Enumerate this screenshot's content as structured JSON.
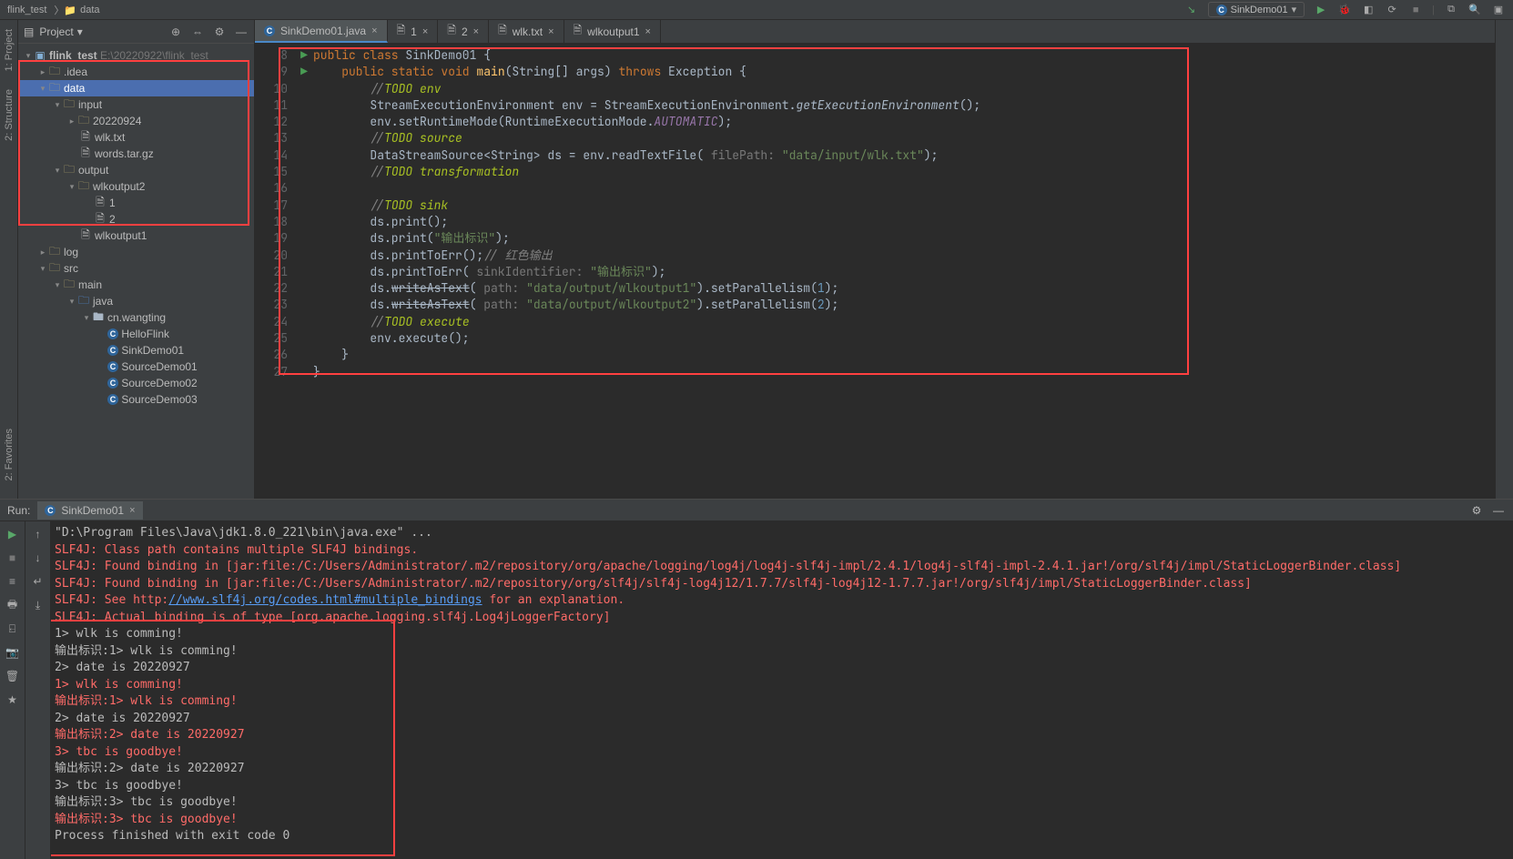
{
  "breadcrumb": {
    "root": "flink_test",
    "current": "data"
  },
  "runConfig": "SinkDemo01",
  "projectPanel": {
    "title": "Project",
    "root": {
      "name": "flink_test",
      "path": "E:\\20220922\\flink_test"
    }
  },
  "tree": {
    "idea": ".idea",
    "data": "data",
    "input": "input",
    "date20220924": "20220924",
    "wlktxt": "wlk.txt",
    "wordstar": "words.tar.gz",
    "output": "output",
    "wlkoutput2": "wlkoutput2",
    "f1": "1",
    "f2": "2",
    "wlkoutput1": "wlkoutput1",
    "log": "log",
    "src": "src",
    "main": "main",
    "java": "java",
    "pkg": "cn.wangting",
    "helloflink": "HelloFlink",
    "sinkdemo01": "SinkDemo01",
    "sourcedemo01": "SourceDemo01",
    "sourcedemo02": "SourceDemo02",
    "sourcedemo03": "SourceDemo03"
  },
  "tabs": {
    "t1": "SinkDemo01.java",
    "t2": "1",
    "t3": "2",
    "t4": "wlk.txt",
    "t5": "wlkoutput1"
  },
  "code": {
    "l8": "public class SinkDemo01 {",
    "l9": "    public static void main(String[] args) throws Exception {",
    "l10": "        //TODO env",
    "l11": "        StreamExecutionEnvironment env = StreamExecutionEnvironment.getExecutionEnvironment();",
    "l12": "        env.setRuntimeMode(RuntimeExecutionMode.AUTOMATIC);",
    "l13": "        //TODO source",
    "l14": "        DataStreamSource<String> ds = env.readTextFile( filePath: \"data/input/wlk.txt\");",
    "l15": "        //TODO transformation",
    "l16": "",
    "l17": "        //TODO sink",
    "l18": "        ds.print();",
    "l19": "        ds.print(\"输出标识\");",
    "l20": "        ds.printToErr();// 红色输出",
    "l21": "        ds.printToErr( sinkIdentifier: \"输出标识\");",
    "l22": "        ds.writeAsText( path: \"data/output/wlkoutput1\").setParallelism(1);",
    "l23": "        ds.writeAsText( path: \"data/output/wlkoutput2\").setParallelism(2);",
    "l24": "        //TODO execute",
    "l25": "        env.execute();",
    "l26": "    }",
    "l27": "}"
  },
  "lineNumbers": [
    "8",
    "9",
    "10",
    "11",
    "12",
    "13",
    "14",
    "15",
    "16",
    "17",
    "18",
    "19",
    "20",
    "21",
    "22",
    "23",
    "24",
    "25",
    "26"
  ],
  "runPanel": {
    "label": "Run:",
    "tab": "SinkDemo01"
  },
  "console": {
    "l1": "\"D:\\Program Files\\Java\\jdk1.8.0_221\\bin\\java.exe\" ...",
    "l2": "SLF4J: Class path contains multiple SLF4J bindings.",
    "l3a": "SLF4J: Found binding in [jar:file:/C:/Users/Administrator/.m2/repository/org/apache/logging/log4j/log4j-slf4j-impl/2.4.1/log4j-slf4j-impl-2.4.1.jar!/org/slf4j/impl/StaticLoggerBinder.class]",
    "l3b": "SLF4J: Found binding in [jar:file:/C:/Users/Administrator/.m2/repository/org/slf4j/slf4j-log4j12/1.7.7/slf4j-log4j12-1.7.7.jar!/org/slf4j/impl/StaticLoggerBinder.class]",
    "l4a": "SLF4J: See http:",
    "l4link": "//www.slf4j.org/codes.html#multiple_bindings",
    "l4b": " for an explanation.",
    "l5": "SLF4J: Actual binding is of type [org.apache.logging.slf4j.Log4jLoggerFactory]",
    "l6": "1> wlk is comming!",
    "l7": "输出标识:1> wlk is comming!",
    "l8": "2> date is 20220927",
    "l9": "1> wlk is comming!",
    "l10": "输出标识:1> wlk is comming!",
    "l11": "2> date is 20220927",
    "l12": "输出标识:2> date is 20220927",
    "l13": "3> tbc is goodbye!",
    "l14": "输出标识:2> date is 20220927",
    "l15": "3> tbc is goodbye!",
    "l16": "输出标识:3> tbc is goodbye!",
    "l17": "输出标识:3> tbc is goodbye!",
    "l18": "",
    "l19": "Process finished with exit code 0"
  },
  "leftRail": {
    "project": "1: Project",
    "structure": "2: Structure",
    "favorites": "2: Favorites"
  }
}
